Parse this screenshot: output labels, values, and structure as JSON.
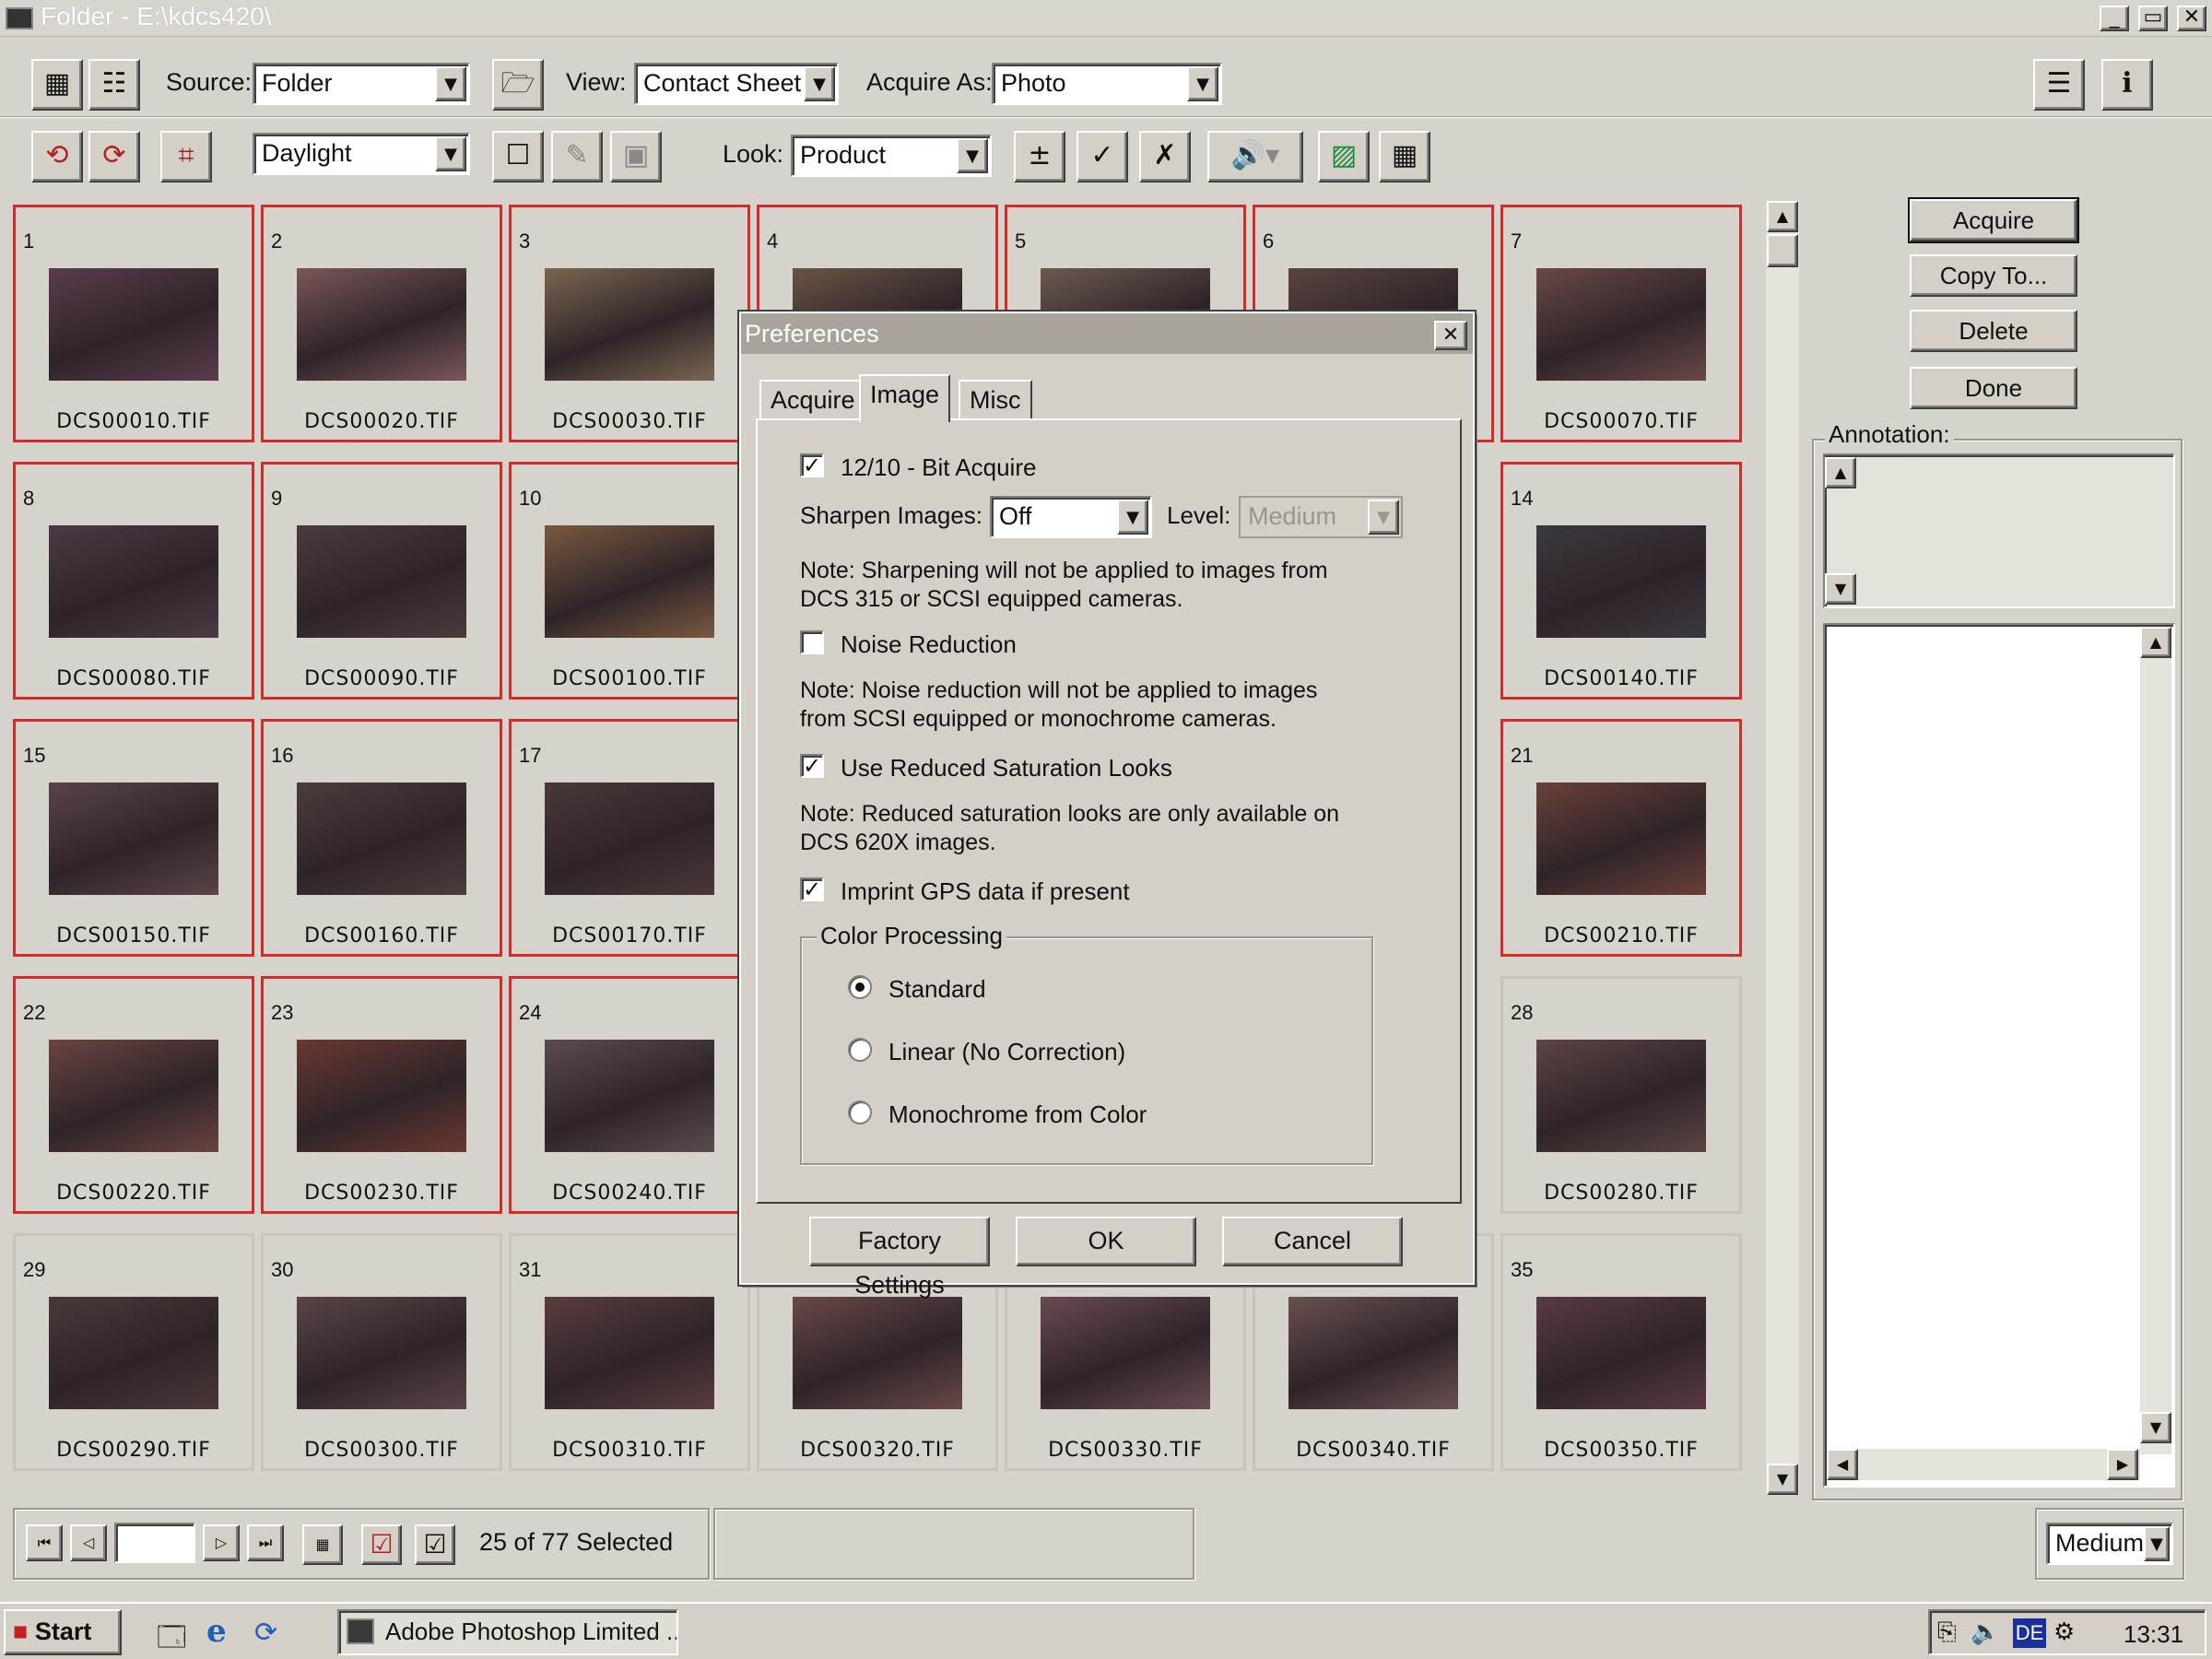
{
  "window": {
    "title": "Folder - E:\\kdcs420\\",
    "min": "_",
    "restore": "▭",
    "close": "✕"
  },
  "toolbar1": {
    "source_label": "Source:",
    "source_value": "Folder",
    "view_label": "View:",
    "view_value": "Contact Sheet",
    "acquire_as_label": "Acquire As:",
    "acquire_as_value": "Photo"
  },
  "toolbar2": {
    "lighting_value": "Daylight",
    "look_label": "Look:",
    "look_value": "Product"
  },
  "thumbnails": [
    {
      "num": "1",
      "file": "DCS00010.TIF",
      "selected": true,
      "color": "#5a3c4c"
    },
    {
      "num": "2",
      "file": "DCS00020.TIF",
      "selected": true,
      "color": "#7a5658"
    },
    {
      "num": "3",
      "file": "DCS00030.TIF",
      "selected": true,
      "color": "#7a6650"
    },
    {
      "num": "4",
      "file": "",
      "selected": true,
      "color": "#6a5444"
    },
    {
      "num": "5",
      "file": "",
      "selected": true,
      "color": "#6c5a50"
    },
    {
      "num": "6",
      "file": "",
      "selected": true,
      "color": "#5a4440"
    },
    {
      "num": "7",
      "file": "DCS00070.TIF",
      "selected": true,
      "color": "#6a4846"
    },
    {
      "num": "8",
      "file": "DCS00080.TIF",
      "selected": true,
      "color": "#4a3a44"
    },
    {
      "num": "9",
      "file": "DCS00090.TIF",
      "selected": true,
      "color": "#4c3a3c"
    },
    {
      "num": "10",
      "file": "DCS00100.TIF",
      "selected": true,
      "color": "#7a5840"
    },
    {
      "num": "",
      "file": "",
      "selected": false,
      "color": ""
    },
    {
      "num": "",
      "file": "",
      "selected": false,
      "color": ""
    },
    {
      "num": "",
      "file": "",
      "selected": false,
      "color": ""
    },
    {
      "num": "14",
      "file": "DCS00140.TIF",
      "selected": true,
      "color": "#3c3840"
    },
    {
      "num": "15",
      "file": "DCS00150.TIF",
      "selected": true,
      "color": "#5a4448"
    },
    {
      "num": "16",
      "file": "DCS00160.TIF",
      "selected": true,
      "color": "#4c3c3c"
    },
    {
      "num": "17",
      "file": "DCS00170.TIF",
      "selected": true,
      "color": "#4a3838"
    },
    {
      "num": "",
      "file": "",
      "selected": false,
      "color": ""
    },
    {
      "num": "",
      "file": "",
      "selected": false,
      "color": ""
    },
    {
      "num": "",
      "file": "",
      "selected": false,
      "color": ""
    },
    {
      "num": "21",
      "file": "DCS00210.TIF",
      "selected": true,
      "color": "#6a4038"
    },
    {
      "num": "22",
      "file": "DCS00220.TIF",
      "selected": true,
      "color": "#6a4440"
    },
    {
      "num": "23",
      "file": "DCS00230.TIF",
      "selected": true,
      "color": "#6a3830"
    },
    {
      "num": "24",
      "file": "DCS00240.TIF",
      "selected": true,
      "color": "#5a4c50"
    },
    {
      "num": "",
      "file": "",
      "selected": false,
      "color": ""
    },
    {
      "num": "",
      "file": "",
      "selected": false,
      "color": ""
    },
    {
      "num": "",
      "file": "",
      "selected": false,
      "color": ""
    },
    {
      "num": "28",
      "file": "DCS00280.TIF",
      "selected": false,
      "color": "#5c4444"
    },
    {
      "num": "29",
      "file": "DCS00290.TIF",
      "selected": false,
      "color": "#4a3838"
    },
    {
      "num": "30",
      "file": "DCS00300.TIF",
      "selected": false,
      "color": "#5a4448"
    },
    {
      "num": "31",
      "file": "DCS00310.TIF",
      "selected": false,
      "color": "#5a3c3e"
    },
    {
      "num": "",
      "file": "DCS00320.TIF",
      "selected": false,
      "color": "#6a4848"
    },
    {
      "num": "",
      "file": "DCS00330.TIF",
      "selected": false,
      "color": "#6a4a52"
    },
    {
      "num": "",
      "file": "DCS00340.TIF",
      "selected": false,
      "color": "#6a5050"
    },
    {
      "num": "35",
      "file": "DCS00350.TIF",
      "selected": false,
      "color": "#5a3a44"
    }
  ],
  "right_panel": {
    "acquire": "Acquire",
    "copy_to": "Copy To...",
    "delete": "Delete",
    "done": "Done",
    "annotation_label": "Annotation:"
  },
  "bottom": {
    "selection_status": "25 of 77 Selected",
    "size_value": "Medium"
  },
  "dialog": {
    "title": "Preferences",
    "close": "✕",
    "tabs": [
      "Acquire",
      "Image",
      "Misc"
    ],
    "active_tab": "Image",
    "bit_acquire": {
      "label": "12/10 - Bit Acquire",
      "checked": "✓"
    },
    "sharpen_label": "Sharpen  Images:",
    "sharpen_value": "Off",
    "level_label": "Level:",
    "level_value": "Medium",
    "note_sharpen": [
      "Note: Sharpening will not be applied to images from",
      "DCS 315 or SCSI equipped cameras."
    ],
    "noise_reduction": {
      "label": "Noise Reduction",
      "checked": ""
    },
    "note_noise": [
      "Note:  Noise reduction will not be applied to images",
      "from SCSI equipped or monochrome cameras."
    ],
    "reduced_saturation": {
      "label": "Use Reduced Saturation Looks",
      "checked": "✓"
    },
    "note_saturation": [
      "Note: Reduced saturation looks are only available on",
      "DCS 620X images."
    ],
    "imprint_gps": {
      "label": "Imprint GPS data if present",
      "checked": "✓"
    },
    "color_processing_label": "Color Processing",
    "color_options": [
      "Standard",
      "Linear (No Correction)",
      "Monochrome from Color"
    ],
    "color_selected": "Standard",
    "factory_settings": "Factory Settings",
    "ok": "OK",
    "cancel": "Cancel"
  },
  "taskbar": {
    "start": "Start",
    "task": "Adobe Photoshop Limited ...",
    "lang": "DE",
    "clock": "13:31"
  }
}
